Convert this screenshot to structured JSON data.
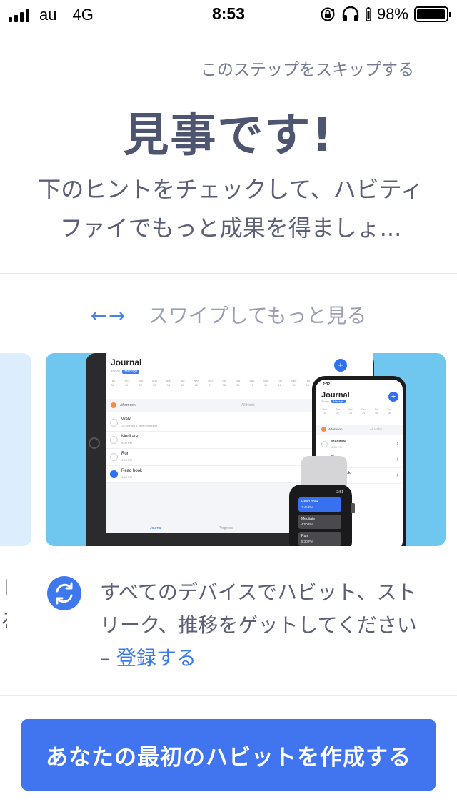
{
  "status_bar": {
    "carrier": "au",
    "network": "4G",
    "time": "8:53",
    "battery": "98%",
    "battery_level": 0.98
  },
  "header": {
    "skip_label": "このステップをスキップする",
    "title": "見事です!",
    "subtitle": "下のヒントをチェックして、ハビティファイでもっと成果を得ましょ..."
  },
  "carousel": {
    "hint_arrows": "←→",
    "hint_label": "スワイプしてもっと見る",
    "tablet": {
      "title": "Journal",
      "tab_today": "Today",
      "tab_manage": "Manage",
      "days": [
        [
          "Thu",
          "31"
        ],
        [
          "Fri",
          "01"
        ],
        [
          "Sat",
          "02"
        ],
        [
          "Sun",
          "03"
        ],
        [
          "Mon",
          "04"
        ],
        [
          "Tue",
          "05"
        ],
        [
          "Wed",
          "06"
        ],
        [
          "Thu",
          "07"
        ],
        [
          "Fri",
          "08"
        ],
        [
          "Sat",
          "09"
        ],
        [
          "Sun",
          "10"
        ],
        [
          "Mon",
          "11"
        ],
        [
          "Tue",
          "12"
        ],
        [
          "Wed",
          "13"
        ],
        [
          "Thu",
          "14"
        ]
      ],
      "section_afternoon": "Afternoon",
      "section_all": "All Habit",
      "habits": [
        {
          "name": "Walk",
          "sub": "11:26 PM • 1 time remaining",
          "done": false
        },
        {
          "name": "Meditate",
          "sub": "4:00 PM",
          "done": false
        },
        {
          "name": "Run",
          "sub": "9:04 PM",
          "done": false
        },
        {
          "name": "Read book",
          "sub": "1:45 PM",
          "done": true
        }
      ],
      "tab_journal": "Journal",
      "tab_progress": "Progress"
    },
    "phone": {
      "time": "2:32",
      "title": "Journal",
      "tab_today": "Today",
      "tab_manage": "Manage",
      "days": [
        [
          "Mon",
          "11"
        ],
        [
          "Tue",
          "12"
        ],
        [
          "Wed",
          "13"
        ],
        [
          "Thu",
          "14"
        ],
        [
          "Fri",
          "15"
        ],
        [
          "Sat",
          "16"
        ]
      ],
      "section_afternoon": "Afternoon",
      "section_all": "All Habit",
      "habits": [
        {
          "name": "Meditate",
          "sub": "4:00 PM"
        },
        {
          "name": "Run",
          "sub": "9:04 PM"
        },
        {
          "name": "Read book",
          "sub": "1:45 PM"
        }
      ]
    },
    "watch": {
      "time": "2:51",
      "items": [
        {
          "name": "Read book",
          "sub": "1:45 PM"
        },
        {
          "name": "Meditate",
          "sub": "4:50 PM"
        },
        {
          "name": "Run",
          "sub": "5:30 PM"
        }
      ]
    }
  },
  "feature": {
    "text": "すべてのデバイスでハビット、ストリーク、推移をゲットしてください – ",
    "link": "登録する",
    "prev_card_chars": "ト\nる"
  },
  "cta": {
    "label": "あなたの最初のハビットを作成する"
  },
  "colors": {
    "accent": "#4175f0",
    "link": "#3b7be9",
    "card_bg": "#6fc6ee",
    "prev_card_bg": "#dceefe"
  }
}
